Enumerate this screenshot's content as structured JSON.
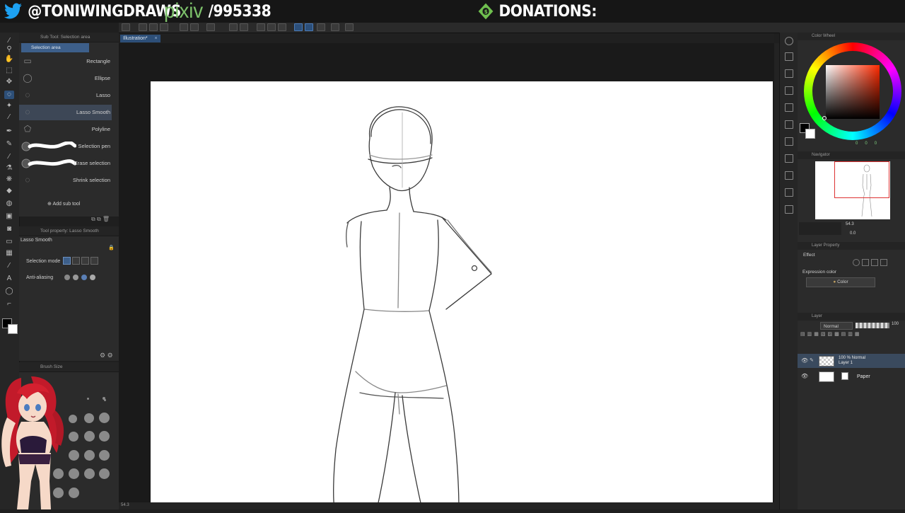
{
  "overlay": {
    "twitter_handle": "@TONIWINGDRAWS",
    "pixiv_logo": "pixiv",
    "pixiv_id": "/995338",
    "donations_label": "DONATIONS:"
  },
  "document": {
    "tab_title": "Illustration*",
    "tab_close": "×"
  },
  "sub_tool": {
    "panel_title": "Sub Tool: Selection area",
    "group_label": "Selection area",
    "items": [
      {
        "label": "Rectangle",
        "icon": "rectangle-select-icon"
      },
      {
        "label": "Ellipse",
        "icon": "ellipse-select-icon"
      },
      {
        "label": "Lasso",
        "icon": "lasso-icon"
      },
      {
        "label": "Lasso Smooth",
        "icon": "lasso-smooth-icon",
        "selected": true
      },
      {
        "label": "Polyline",
        "icon": "polyline-icon"
      },
      {
        "label": "Selection pen",
        "icon": "selection-pen-icon"
      },
      {
        "label": "Erase selection",
        "icon": "erase-selection-icon"
      },
      {
        "label": "Shrink selection",
        "icon": "shrink-selection-icon"
      }
    ],
    "add_sub_tool": "Add sub tool"
  },
  "tool_property": {
    "panel_title": "Tool property: Lasso Smooth",
    "tool_name": "Lasso Smooth",
    "selection_mode_label": "Selection mode",
    "anti_aliasing_label": "Anti-aliasing"
  },
  "brush_size": {
    "panel_title": "Brush Size"
  },
  "color_wheel": {
    "panel_title": "Color Wheel",
    "values": [
      "0",
      "0",
      "0"
    ]
  },
  "navigator": {
    "panel_title": "Navigator",
    "zoom": "54.3",
    "rotation": "0.0"
  },
  "layer_property": {
    "panel_title": "Layer Property",
    "effect_label": "Effect",
    "expression_color_label": "Expression color",
    "expression_color_value": "Color"
  },
  "layers": {
    "panel_title": "Layer",
    "blend_mode": "Normal",
    "opacity": "100",
    "items": [
      {
        "line1": "100 % Normal",
        "line2": "Layer 1",
        "selected": true
      },
      {
        "line1": "Paper",
        "line2": "",
        "selected": false
      }
    ]
  },
  "status": {
    "zoom": "54.3"
  },
  "colors": {
    "accent": "#2d4f78",
    "pixiv_green": "#7cc06a",
    "donation_green": "#6fbf4f",
    "twitter_blue": "#1da1f2"
  }
}
